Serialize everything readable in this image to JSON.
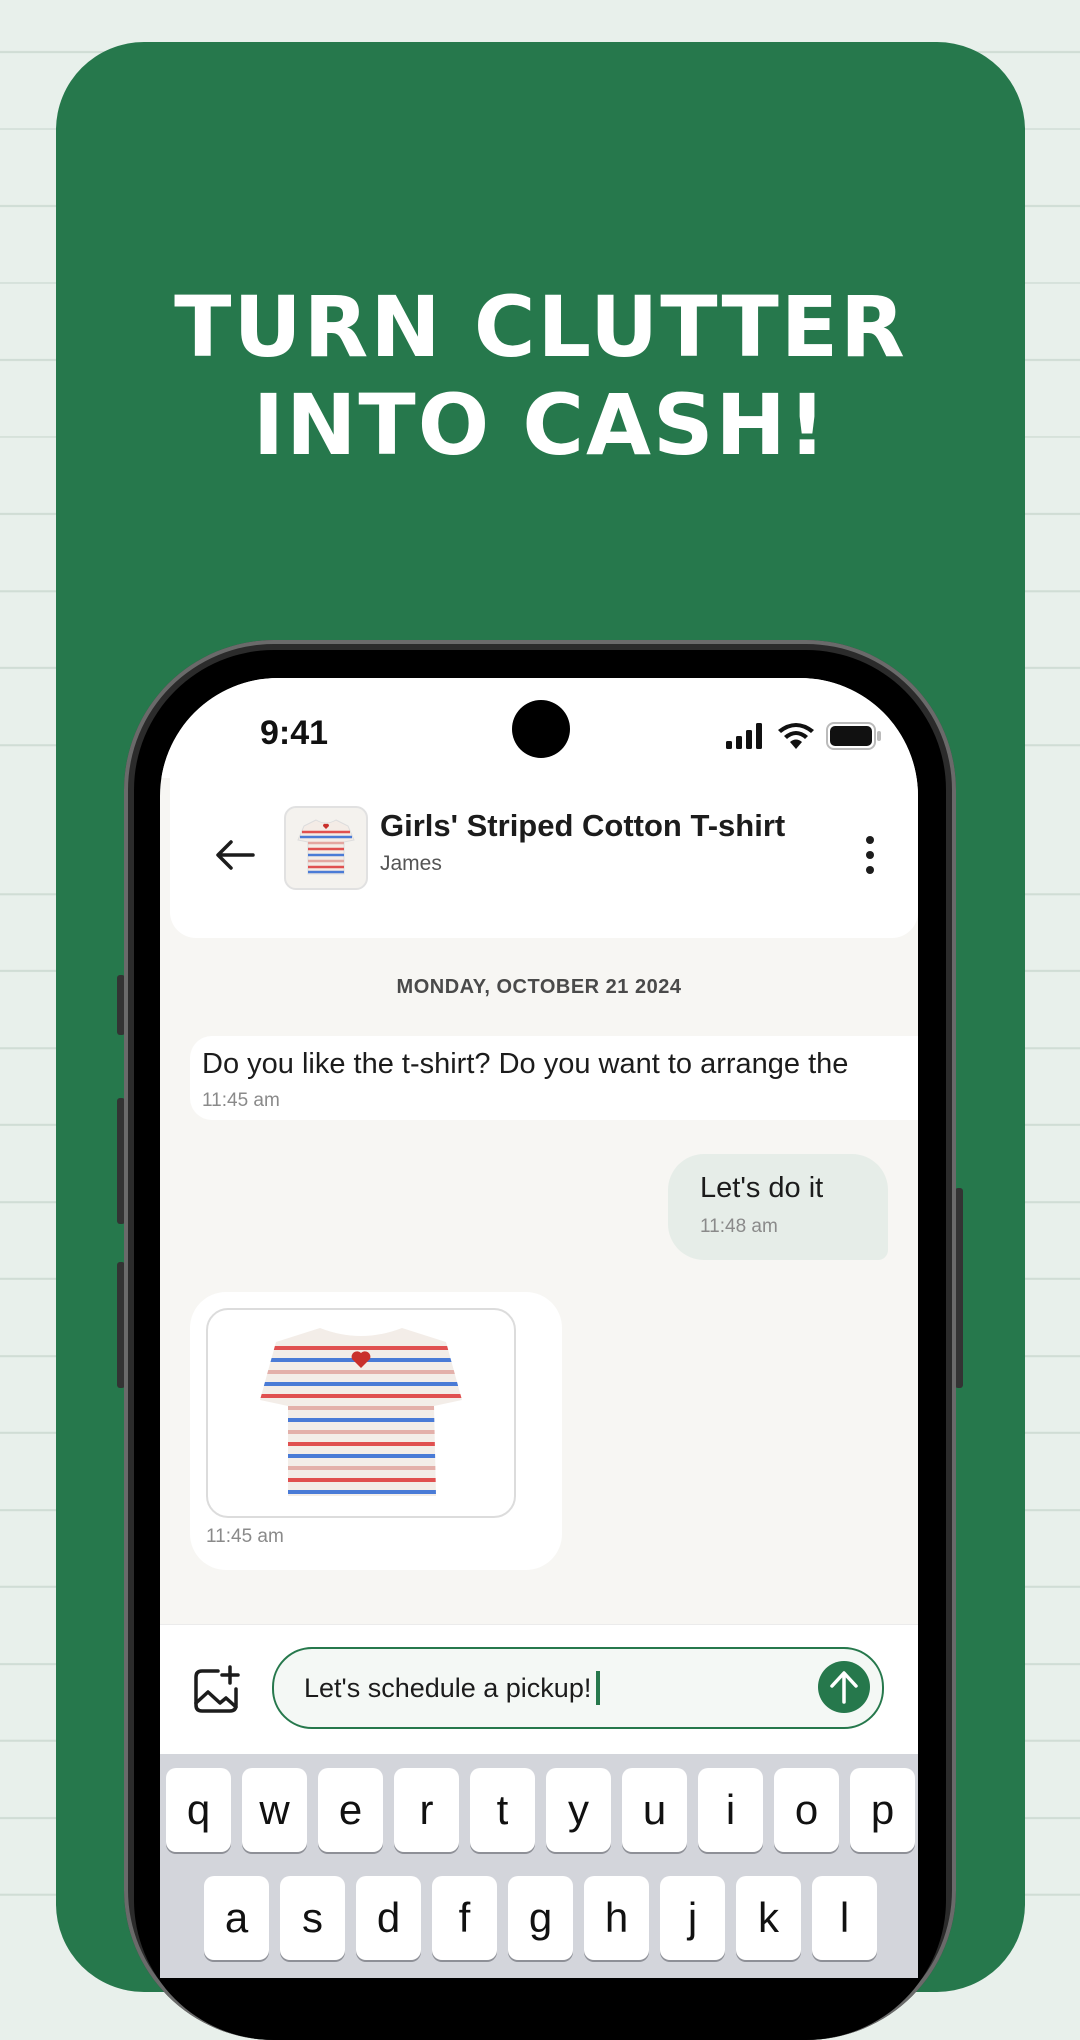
{
  "hero": {
    "headline_line1": "TURN CLUTTER",
    "headline_line2": "INTO CASH!",
    "bg_color": "#26784c"
  },
  "status_bar": {
    "time": "9:41",
    "icons": [
      "cellular-signal-icon",
      "wifi-icon",
      "battery-icon"
    ]
  },
  "chat_header": {
    "title": "Girls' Striped Cotton T-shirt",
    "subtitle": "James",
    "back_icon": "arrow-left-icon",
    "menu_icon": "more-vertical-icon"
  },
  "conversation": {
    "date_separator": "MONDAY, OCTOBER 21 2024",
    "messages": [
      {
        "direction": "incoming",
        "text": "Do you like the t-shirt? Do you want to arrange the",
        "time": "11:45 am"
      },
      {
        "direction": "outgoing",
        "text": "Let's do it",
        "time": "11:48 am"
      },
      {
        "direction": "incoming",
        "type": "image",
        "alt": "striped t-shirt photo",
        "time": "11:45 am"
      }
    ]
  },
  "composer": {
    "value": "Let's schedule a pickup!",
    "attach_icon": "add-image-icon",
    "send_icon": "arrow-up-icon"
  },
  "keyboard": {
    "row1": [
      "q",
      "w",
      "e",
      "r",
      "t",
      "y",
      "u",
      "i",
      "o",
      "p"
    ],
    "row2": [
      "a",
      "s",
      "d",
      "f",
      "g",
      "h",
      "j",
      "k",
      "l"
    ]
  }
}
